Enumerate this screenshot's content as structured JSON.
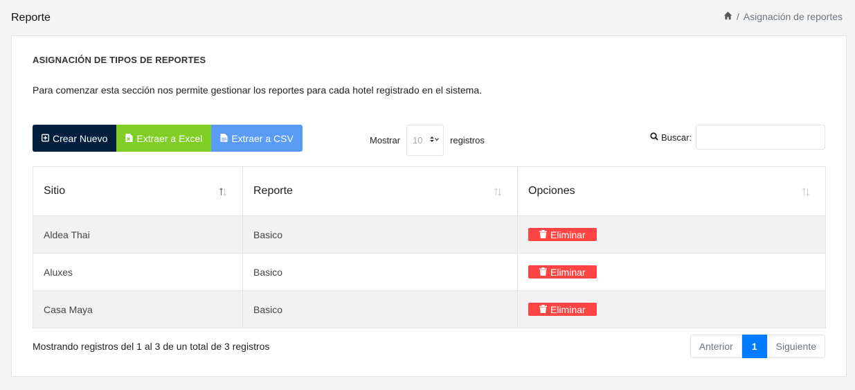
{
  "header": {
    "title": "Reporte",
    "breadcrumb_current": "Asignación de reportes",
    "breadcrumb_separator": "/"
  },
  "card": {
    "title": "ASIGNACIÓN DE TIPOS DE REPORTES",
    "description": "Para comenzar esta sección nos permite gestionar los reportes para cada hotel registrado en el sistema."
  },
  "toolbar": {
    "new_label": "Crear Nuevo",
    "excel_label": "Extraer a Excel",
    "csv_label": "Extraer a CSV"
  },
  "length": {
    "prefix": "Mostrar",
    "value": "10",
    "suffix": "registros"
  },
  "search": {
    "label": "Buscar:",
    "value": ""
  },
  "table": {
    "headers": [
      "Sitio",
      "Reporte",
      "Opciones"
    ],
    "rows": [
      {
        "sitio": "Aldea Thai",
        "reporte": "Basico",
        "action": "Eliminar"
      },
      {
        "sitio": "Aluxes",
        "reporte": "Basico",
        "action": "Eliminar"
      },
      {
        "sitio": "Casa Maya",
        "reporte": "Basico",
        "action": "Eliminar"
      }
    ]
  },
  "footer": {
    "info": "Mostrando registros del 1 al 3 de un total de 3 registros",
    "prev_label": "Anterior",
    "page": "1",
    "next_label": "Siguiente"
  },
  "colors": {
    "new_button": "#001f3f",
    "excel_button": "#7fcd25",
    "csv_button": "#5a9bf6",
    "delete_button": "#ff4444",
    "active_page": "#007bff"
  }
}
